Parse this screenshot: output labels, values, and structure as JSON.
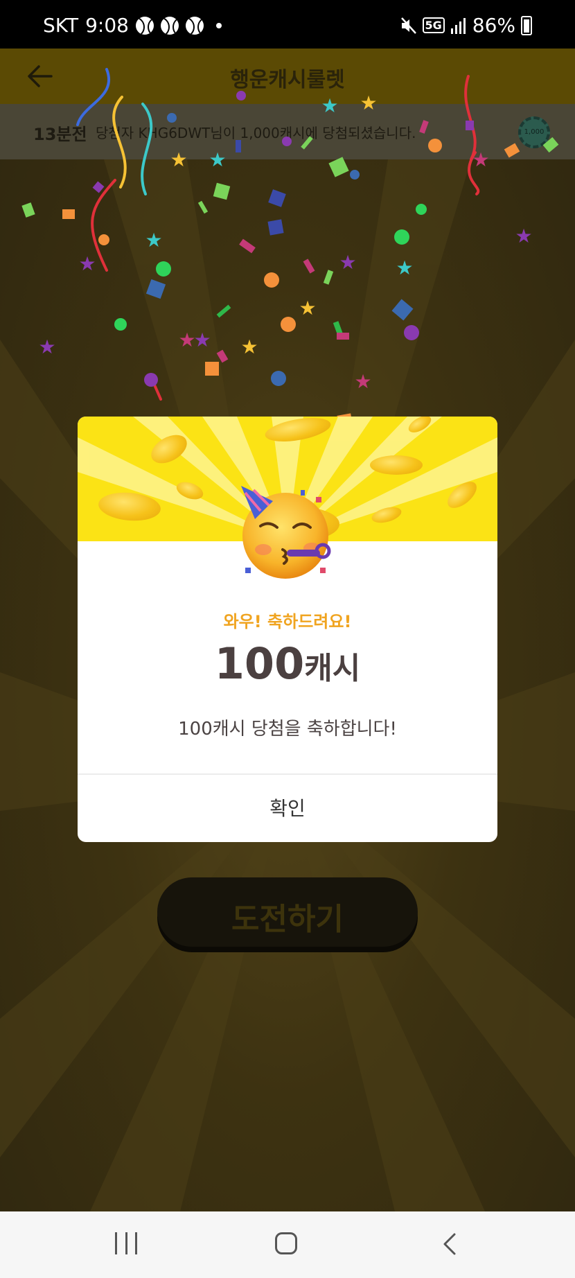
{
  "status_bar": {
    "carrier": "SKT",
    "time": "9:08",
    "network": "5G",
    "battery": "86%",
    "icons": [
      "baseball-icon",
      "baseball-icon",
      "baseball-icon",
      "dot-icon",
      "mute-icon",
      "5g-icon",
      "signal-icon",
      "battery-charging-icon"
    ]
  },
  "header": {
    "title": "행운캐시룰렛",
    "back_icon": "back-arrow-icon"
  },
  "ticker": {
    "time": "13분전",
    "message": "당첨자 KHG6DWT님이 1,000캐시에 당첨되셨습니다.",
    "chip_label": "1,000"
  },
  "challenge_button": {
    "label": "도전하기"
  },
  "modal": {
    "kicker": "와우! 축하드려요!",
    "amount": "100",
    "amount_unit": "캐시",
    "message": "100캐시 당첨을 축하합니다!",
    "confirm_label": "확인",
    "emoji": "partying-face-emoji"
  },
  "colors": {
    "banner_yellow": "#fbe315",
    "kicker_orange": "#f0a420",
    "amount_text": "#4b4040"
  },
  "nav_bar": {
    "icons": [
      "recents-icon",
      "home-icon",
      "back-icon"
    ]
  }
}
